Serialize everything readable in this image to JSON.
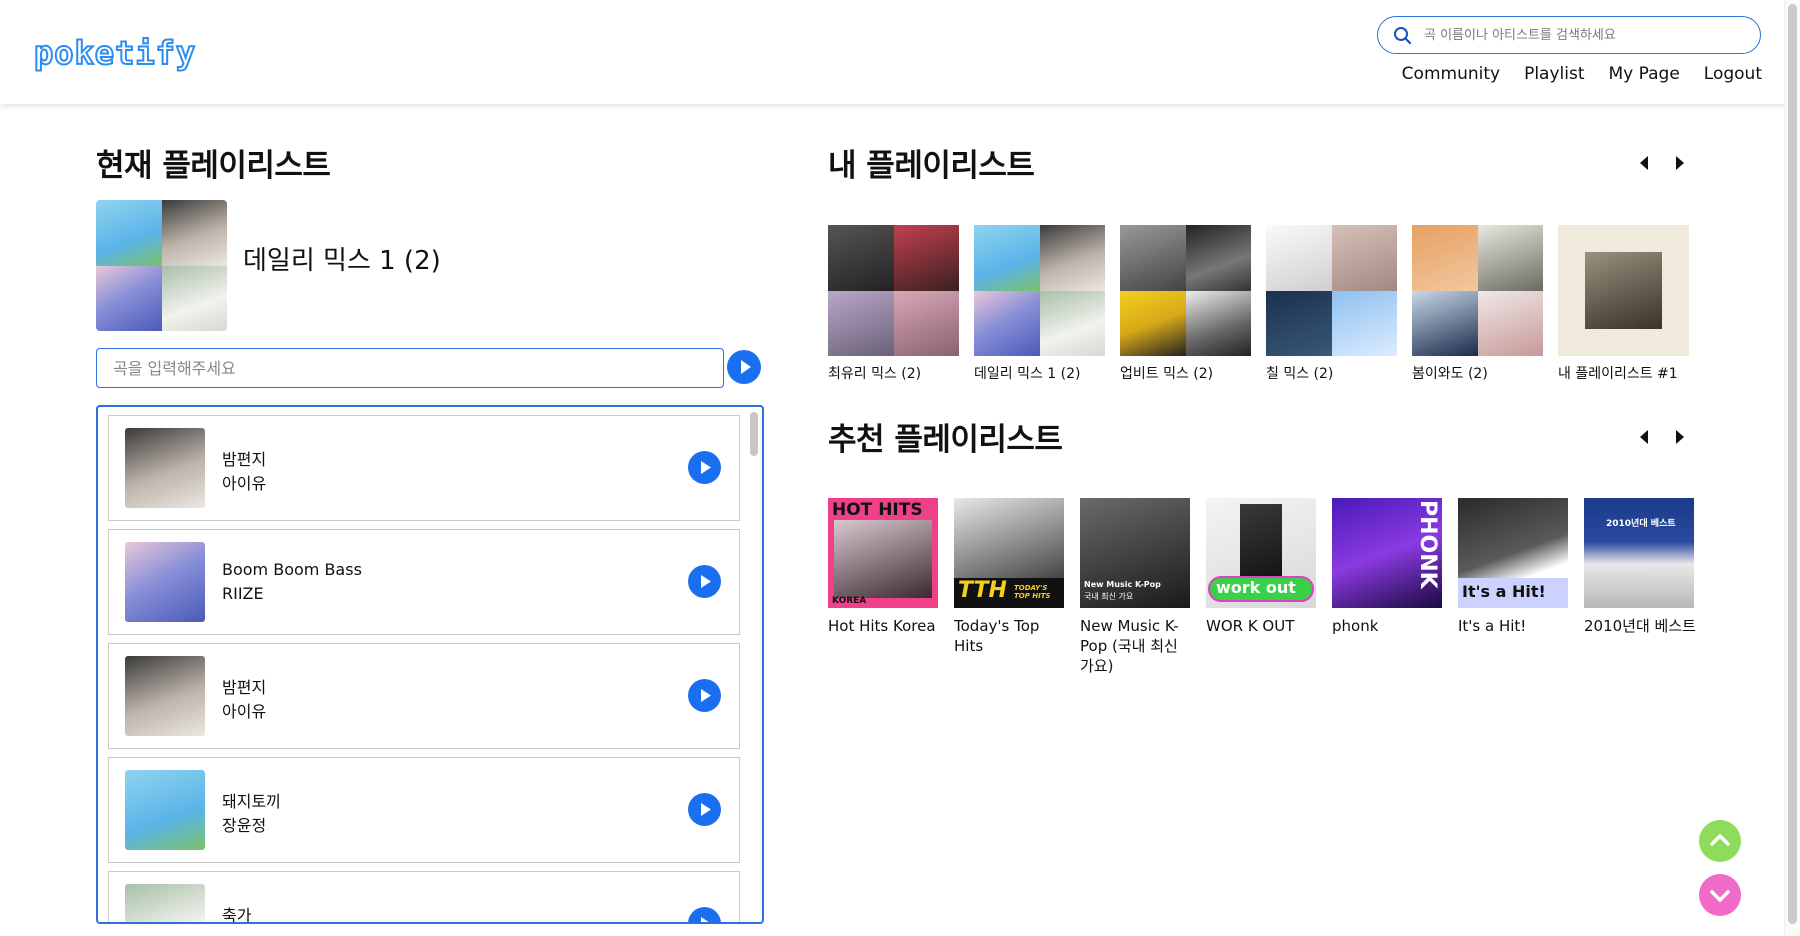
{
  "header": {
    "logo": "poketify",
    "search_placeholder": "곡 이름이나 아티스트를 검색하세요",
    "nav": [
      "Community",
      "Playlist",
      "My Page",
      "Logout"
    ]
  },
  "current": {
    "section_title": "현재 플레이리스트",
    "playlist_name": "데일리 믹스 1 (2)",
    "song_input_placeholder": "곡을 입력해주세요",
    "songs": [
      {
        "title": "밤편지",
        "artist": "아이유"
      },
      {
        "title": "Boom Boom Bass",
        "artist": "RIIZE"
      },
      {
        "title": "밤편지",
        "artist": "아이유"
      },
      {
        "title": "돼지토끼",
        "artist": "장윤정"
      },
      {
        "title": "축가",
        "artist": ""
      }
    ]
  },
  "my_playlists": {
    "section_title": "내 플레이리스트",
    "items": [
      {
        "name": "최유리 믹스 (2)"
      },
      {
        "name": "데일리 믹스 1 (2)"
      },
      {
        "name": "업비트 믹스 (2)"
      },
      {
        "name": "칠 믹스 (2)"
      },
      {
        "name": "봄이와도 (2)"
      },
      {
        "name": "내 플레이리스트 #1"
      }
    ]
  },
  "recommended": {
    "section_title": "추천 플레이리스트",
    "items": [
      {
        "name": "Hot Hits Korea",
        "cover_text": "HOT HITS",
        "cover_sub": "KOREA"
      },
      {
        "name": "Today's Top Hits",
        "cover_text": "TTH",
        "cover_sub": "TODAY'S TOP HITS"
      },
      {
        "name": "New Music K-Pop (국내 최신 가요)",
        "cover_text": "New Music K-Pop",
        "cover_sub": "국내 최신 가요"
      },
      {
        "name": "WOR K OUT",
        "cover_text": "work out",
        "cover_sub": ""
      },
      {
        "name": "phonk",
        "cover_text": "PHONK",
        "cover_sub": ""
      },
      {
        "name": "It's a Hit!",
        "cover_text": "It's a Hit!",
        "cover_sub": ""
      },
      {
        "name": "2010년대 베스트",
        "cover_text": "2010년대 베스트",
        "cover_sub": ""
      }
    ]
  },
  "colors": {
    "accent": "#1a6ff0",
    "scroll_up": "#8fdc5a",
    "scroll_down": "#f06bc8"
  }
}
